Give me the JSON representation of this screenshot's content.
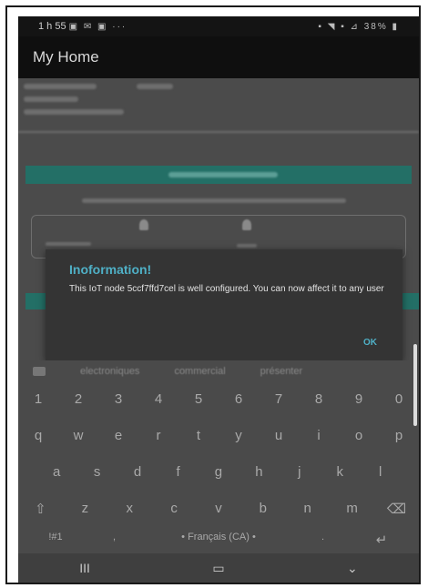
{
  "status_bar": {
    "time": "1 h 55",
    "left_icons": "▣ ✉ ▣ ···",
    "right_text": "▪ ◥ ▪ ⊿ 38% ▮"
  },
  "app_bar": {
    "title": "My Home"
  },
  "dialog": {
    "title": "Inoformation!",
    "message": "This IoT node 5ccf7ffd7cel is well configured. You can now affect it to any user",
    "ok_label": "OK"
  },
  "keyboard": {
    "suggestions": [
      "electroniques",
      "commercial",
      "présenter"
    ],
    "rows": [
      [
        "1",
        "2",
        "3",
        "4",
        "5",
        "6",
        "7",
        "8",
        "9",
        "0"
      ],
      [
        "q",
        "w",
        "e",
        "r",
        "t",
        "y",
        "u",
        "i",
        "o",
        "p"
      ],
      [
        "a",
        "s",
        "d",
        "f",
        "g",
        "h",
        "j",
        "k",
        "l"
      ],
      [
        "⇧",
        "z",
        "x",
        "c",
        "v",
        "b",
        "n",
        "m",
        "⌫"
      ],
      [
        "!#1",
        ",",
        "• Français (CA) •",
        ".",
        "↵"
      ]
    ]
  },
  "nav": {
    "recent": "III",
    "home": "▭",
    "back": "⌄"
  },
  "colors": {
    "accent": "#4fb0c6",
    "teal_bar": "#236f66",
    "dialog_bg": "#343434"
  }
}
